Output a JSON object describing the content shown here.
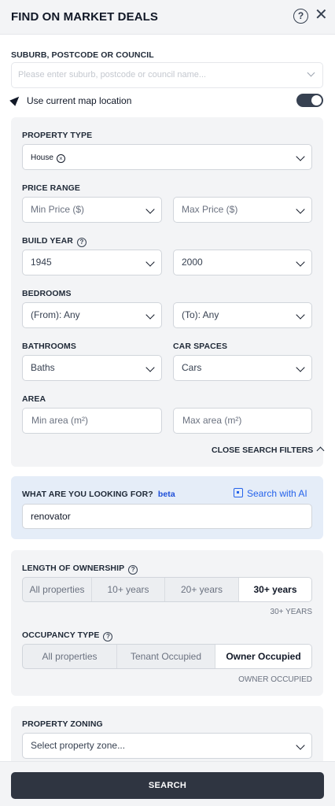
{
  "header": {
    "title": "FIND ON MARKET DEALS"
  },
  "location": {
    "label": "SUBURB, POSTCODE OR COUNCIL",
    "placeholder": "Please enter suburb, postcode or council name...",
    "use_map_label": "Use current map location",
    "use_map_enabled": true
  },
  "filters": {
    "property_type": {
      "label": "PROPERTY TYPE",
      "selected_tag": "House"
    },
    "price_range": {
      "label": "PRICE RANGE",
      "min_placeholder": "Min Price ($)",
      "max_placeholder": "Max Price ($)"
    },
    "build_year": {
      "label": "BUILD YEAR",
      "from": "1945",
      "to": "2000"
    },
    "bedrooms": {
      "label": "BEDROOMS",
      "from": "(From): Any",
      "to": "(To): Any"
    },
    "bathrooms": {
      "label": "BATHROOMS",
      "value": "Baths"
    },
    "car_spaces": {
      "label": "CAR SPACES",
      "value": "Cars"
    },
    "area": {
      "label": "AREA",
      "min_placeholder": "Min area (m²)",
      "max_placeholder": "Max area (m²)"
    },
    "close_label": "CLOSE SEARCH FILTERS"
  },
  "ai_search": {
    "label": "WHAT ARE YOU LOOKING FOR?",
    "beta": "beta",
    "button": "Search with AI",
    "value": "renovator"
  },
  "ownership": {
    "label": "LENGTH OF OWNERSHIP",
    "options": [
      "All properties",
      "10+ years",
      "20+ years",
      "30+ years"
    ],
    "selected": "30+ years",
    "hint": "30+ YEARS"
  },
  "occupancy": {
    "label": "OCCUPANCY TYPE",
    "options": [
      "All properties",
      "Tenant Occupied",
      "Owner Occupied"
    ],
    "selected": "Owner Occupied",
    "hint": "OWNER OCCUPIED"
  },
  "zoning": {
    "label": "PROPERTY ZONING",
    "placeholder": "Select property zone..."
  },
  "footer": {
    "search_label": "SEARCH"
  },
  "colors": {
    "primary_dark": "#2f3541",
    "accent_blue": "#2563eb",
    "panel_bg": "#f3f4f6",
    "ai_panel_bg": "#e5edf8"
  }
}
